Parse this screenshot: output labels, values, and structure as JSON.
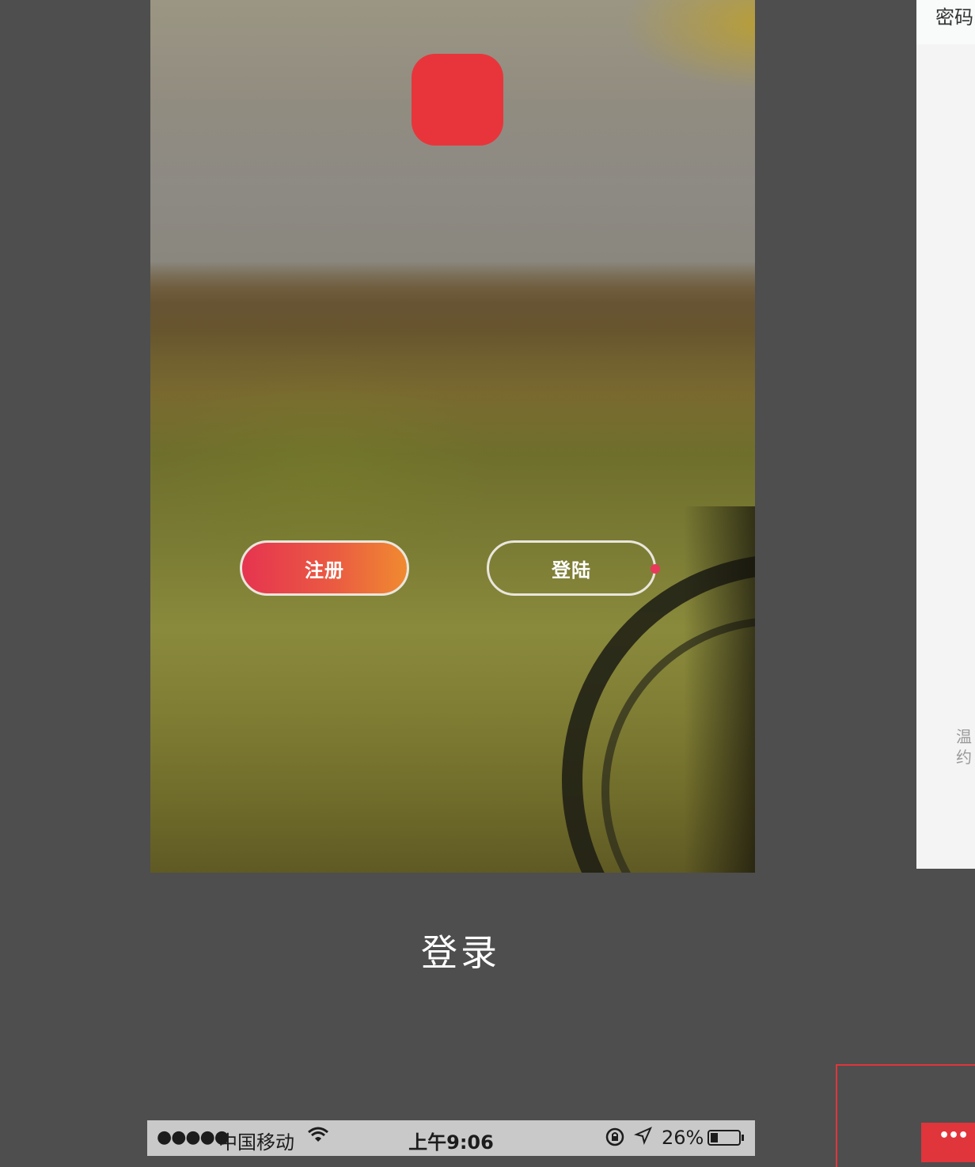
{
  "main_screen": {
    "buttons": {
      "register_label": "注册",
      "login_label": "登陆"
    },
    "colors": {
      "logo": "#e8353c",
      "register_gradient_start": "#e63450",
      "register_gradient_end": "#f08a30",
      "login_dot": "#e8395a"
    }
  },
  "caption": "登录",
  "side_screen": {
    "password_label": "密码",
    "note_lines": [
      "温",
      "约"
    ]
  },
  "status_bar": {
    "signal": "●●●●●",
    "carrier": "中国移动",
    "time": "上午9:06",
    "battery_text": "26%",
    "battery_level": 0.26
  },
  "corner_tab": {
    "dots": "•••"
  }
}
